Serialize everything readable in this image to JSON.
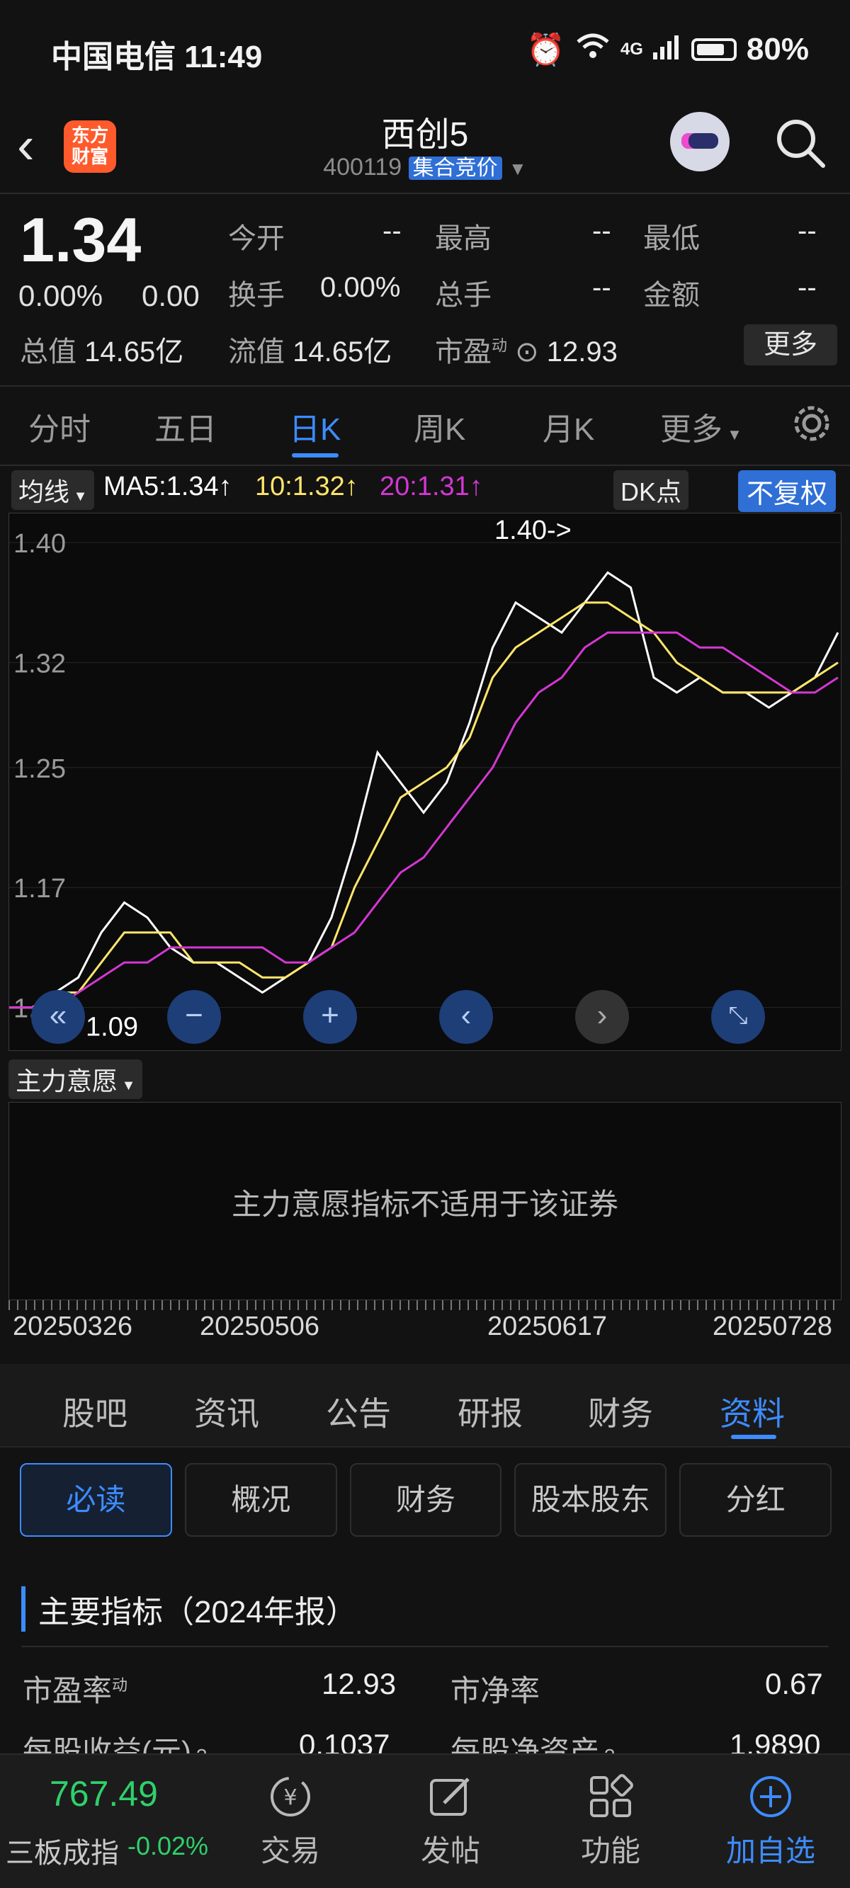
{
  "status": {
    "carrier_time": "中国电信 11:49",
    "battery": "80%",
    "net": "4G"
  },
  "header": {
    "logo_line1": "东方",
    "logo_line2": "财富",
    "title": "西创5",
    "code": "400119",
    "tag": "集合竞价"
  },
  "quote": {
    "price": "1.34",
    "pct": "0.00%",
    "chg": "0.00",
    "open_label": "今开",
    "open": "--",
    "high_label": "最高",
    "high": "--",
    "low_label": "最低",
    "low": "--",
    "turnover_label": "换手",
    "turnover": "0.00%",
    "volume_label": "总手",
    "volume": "--",
    "amount_label": "金额",
    "amount": "--",
    "mcap_label": "总值",
    "mcap": "14.65亿",
    "float_label": "流值",
    "float": "14.65亿",
    "pe_label": "市盈",
    "pe_sup": "动",
    "pe": "12.93",
    "more": "更多"
  },
  "tabs": [
    "分时",
    "五日",
    "日K",
    "周K",
    "月K",
    "更多"
  ],
  "indicators": {
    "ma_label": "均线",
    "ma5": "MA5:1.34↑",
    "ma10": "10:1.32↑",
    "ma20": "20:1.31↑",
    "dk": "DK点",
    "adjust": "不复权",
    "color_ma5": "#ffffff",
    "color_ma10": "#ffe66a",
    "color_ma20": "#d437d4"
  },
  "chart_data": {
    "type": "line",
    "y_ticks": [
      "1.40",
      "1.32",
      "1.25",
      "1.17",
      "1.09"
    ],
    "ylim": [
      1.07,
      1.41
    ],
    "max_note": "1.40->",
    "min_note": "←1.09",
    "x_ticks": [
      "20250326",
      "20250506",
      "20250617",
      "20250728"
    ],
    "series": [
      {
        "name": "MA5",
        "values": [
          1.09,
          1.09,
          1.1,
          1.11,
          1.14,
          1.16,
          1.15,
          1.13,
          1.12,
          1.12,
          1.11,
          1.1,
          1.11,
          1.12,
          1.15,
          1.2,
          1.26,
          1.24,
          1.22,
          1.24,
          1.28,
          1.33,
          1.36,
          1.35,
          1.34,
          1.36,
          1.38,
          1.37,
          1.31,
          1.3,
          1.31,
          1.3,
          1.3,
          1.29,
          1.3,
          1.31,
          1.34
        ]
      },
      {
        "name": "10",
        "values": [
          1.09,
          1.09,
          1.1,
          1.1,
          1.12,
          1.14,
          1.14,
          1.14,
          1.12,
          1.12,
          1.12,
          1.11,
          1.11,
          1.12,
          1.13,
          1.17,
          1.2,
          1.23,
          1.24,
          1.25,
          1.27,
          1.31,
          1.33,
          1.34,
          1.35,
          1.36,
          1.36,
          1.35,
          1.34,
          1.32,
          1.31,
          1.3,
          1.3,
          1.3,
          1.3,
          1.31,
          1.32
        ]
      },
      {
        "name": "20",
        "values": [
          1.09,
          1.09,
          1.09,
          1.1,
          1.11,
          1.12,
          1.12,
          1.13,
          1.13,
          1.13,
          1.13,
          1.13,
          1.12,
          1.12,
          1.13,
          1.14,
          1.16,
          1.18,
          1.19,
          1.21,
          1.23,
          1.25,
          1.28,
          1.3,
          1.31,
          1.33,
          1.34,
          1.34,
          1.34,
          1.34,
          1.33,
          1.33,
          1.32,
          1.31,
          1.3,
          1.3,
          1.31
        ]
      }
    ]
  },
  "controls": {
    "zoomout_icon": "minus-icon",
    "zoomin_icon": "plus-icon"
  },
  "indicator2": {
    "label": "主力意愿",
    "message": "主力意愿指标不适用于该证券"
  },
  "sub_tabs": [
    "股吧",
    "资讯",
    "公告",
    "研报",
    "财务",
    "资料"
  ],
  "info_buttons": [
    "必读",
    "概况",
    "财务",
    "股本股东",
    "分红"
  ],
  "section": {
    "title": "主要指标（2024年报）"
  },
  "metrics": [
    {
      "label": "市盈率",
      "sup": "动",
      "value": "12.93",
      "label2": "市净率",
      "value2": "0.67"
    },
    {
      "label": "每股收益(元)",
      "value": "0.1037",
      "label2": "每股净资产",
      "value2": "1.9890"
    }
  ],
  "bottom": {
    "index_value": "767.49",
    "index_label": "三板成指",
    "index_chg": "-0.02%",
    "items": [
      "交易",
      "发帖",
      "功能",
      "加自选"
    ]
  }
}
